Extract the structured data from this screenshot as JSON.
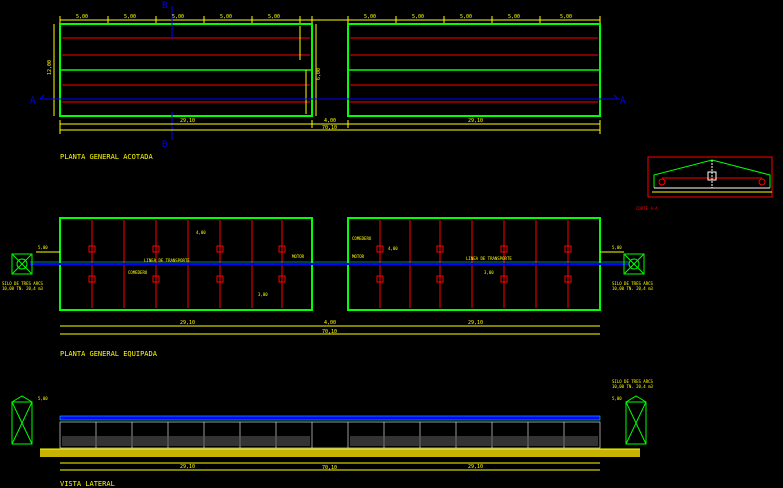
{
  "titles": {
    "plan_dimensioned": "PLANTA GENERAL ACOTADA",
    "plan_equipped": "PLANTA GENERAL EQUIPADA",
    "side_view": "VISTA LATERAL",
    "section": "CORTE A-A"
  },
  "section_marks": {
    "top": "B",
    "bottom": "B",
    "left": "A",
    "right": "A"
  },
  "dims": {
    "bay_labels": [
      "5,00",
      "5,00",
      "5,00",
      "5,00",
      "5,00",
      "5,00"
    ],
    "width": "12,00",
    "half_width": "6,00",
    "gap": "4,00",
    "block_length": "29,10",
    "total_length": "70,10",
    "motor_offset": "5,00",
    "sample_a": "4,00",
    "sample_b": "3,00"
  },
  "labels": {
    "motor_left": "MOTOR",
    "motor_right": "MOTOR",
    "comedero_left": "COMEDERO",
    "comedero_right": "COMEDERO",
    "linea_left": "LINEA DE TRANSPORTE",
    "linea_right": "LINEA DE TRANSPORTE",
    "silo_left_1": "SILO DE TRES ARCS",
    "silo_left_2": "10,00 TN. 20,4 m3",
    "silo_right_1": "SILO DE TRES ARCS",
    "silo_right_2": "10,00 TN. 20,4 m3",
    "silo_side_1": "SILO DE TRES ARCS",
    "silo_side_2": "10,00 TN. 20,4 m3"
  },
  "colors": {
    "wall": "#00ff00",
    "dim": "#ffff00",
    "red": "#ff0000",
    "blue": "#0000ff",
    "cyan": "#00ffff",
    "white": "#ffffff",
    "magenta": "#ff00ff"
  }
}
